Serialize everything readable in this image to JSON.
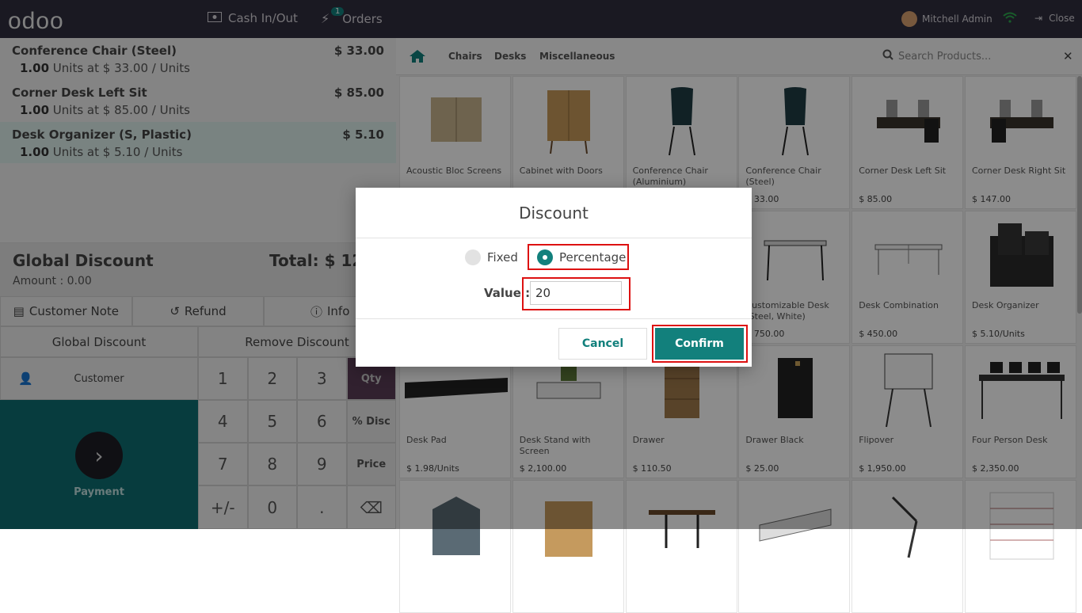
{
  "topbar": {
    "logo": "odoo",
    "cash_in_out": "Cash In/Out",
    "orders": "Orders",
    "orders_badge": "1",
    "user": "Mitchell Admin",
    "close": "Close"
  },
  "orderlines": [
    {
      "name": "Conference Chair (Steel)",
      "price": "$ 33.00",
      "qty": "1.00",
      "unit_info": "Units at $ 33.00 / Units"
    },
    {
      "name": "Corner Desk Left Sit",
      "price": "$ 85.00",
      "qty": "1.00",
      "unit_info": "Units at $ 85.00 / Units"
    },
    {
      "name": "Desk Organizer (S, Plastic)",
      "price": "$ 5.10",
      "qty": "1.00",
      "unit_info": "Units at $ 5.10 / Units"
    }
  ],
  "summary": {
    "global_discount": "Global Discount",
    "amount_label": "Amount :",
    "amount_value": "0.00",
    "total": "Total: $ 123"
  },
  "control_buttons": {
    "customer_note": "Customer Note",
    "refund": "Refund",
    "info": "Info",
    "global_discount": "Global Discount",
    "remove_discount": "Remove Discount",
    "customer": "Customer",
    "payment": "Payment"
  },
  "numpad": {
    "keys": [
      "1",
      "2",
      "3",
      "4",
      "5",
      "6",
      "7",
      "8",
      "9",
      "+/-",
      "0",
      "."
    ],
    "modes": [
      "Qty",
      "% Disc",
      "Price"
    ]
  },
  "categories": [
    "Chairs",
    "Desks",
    "Miscellaneous"
  ],
  "search": {
    "placeholder": "Search Products..."
  },
  "products": [
    {
      "name": "Acoustic Bloc Screens",
      "price": ""
    },
    {
      "name": "Cabinet with Doors",
      "price": ""
    },
    {
      "name": "Conference Chair (Aluminium)",
      "price": ""
    },
    {
      "name": "Conference Chair (Steel)",
      "price": "$ 33.00"
    },
    {
      "name": "Corner Desk Left Sit",
      "price": "$ 85.00"
    },
    {
      "name": "Corner Desk Right Sit",
      "price": "$ 147.00"
    },
    {
      "name": "",
      "price": ""
    },
    {
      "name": "",
      "price": ""
    },
    {
      "name": "",
      "price": ""
    },
    {
      "name": "Customizable Desk (Steel, White)",
      "price": "$ 750.00"
    },
    {
      "name": "Desk Combination",
      "price": "$ 450.00"
    },
    {
      "name": "Desk Organizer",
      "price": "$ 5.10/Units"
    },
    {
      "name": "Desk Pad",
      "price": "$ 1.98/Units"
    },
    {
      "name": "Desk Stand with Screen",
      "price": "$ 2,100.00"
    },
    {
      "name": "Drawer",
      "price": "$ 110.50"
    },
    {
      "name": "Drawer Black",
      "price": "$ 25.00"
    },
    {
      "name": "Flipover",
      "price": "$ 1,950.00"
    },
    {
      "name": "Four Person Desk",
      "price": "$ 2,350.00"
    },
    {
      "name": "",
      "price": ""
    },
    {
      "name": "",
      "price": ""
    },
    {
      "name": "",
      "price": ""
    },
    {
      "name": "",
      "price": ""
    },
    {
      "name": "",
      "price": ""
    },
    {
      "name": "",
      "price": ""
    }
  ],
  "modal": {
    "title": "Discount",
    "fixed": "Fixed",
    "percentage": "Percentage",
    "value_label": "Value :",
    "value": "20",
    "cancel": "Cancel",
    "confirm": "Confirm"
  },
  "colors": {
    "accent": "#12807c",
    "topbar": "#302f3f",
    "highlight": "#dd1111"
  }
}
